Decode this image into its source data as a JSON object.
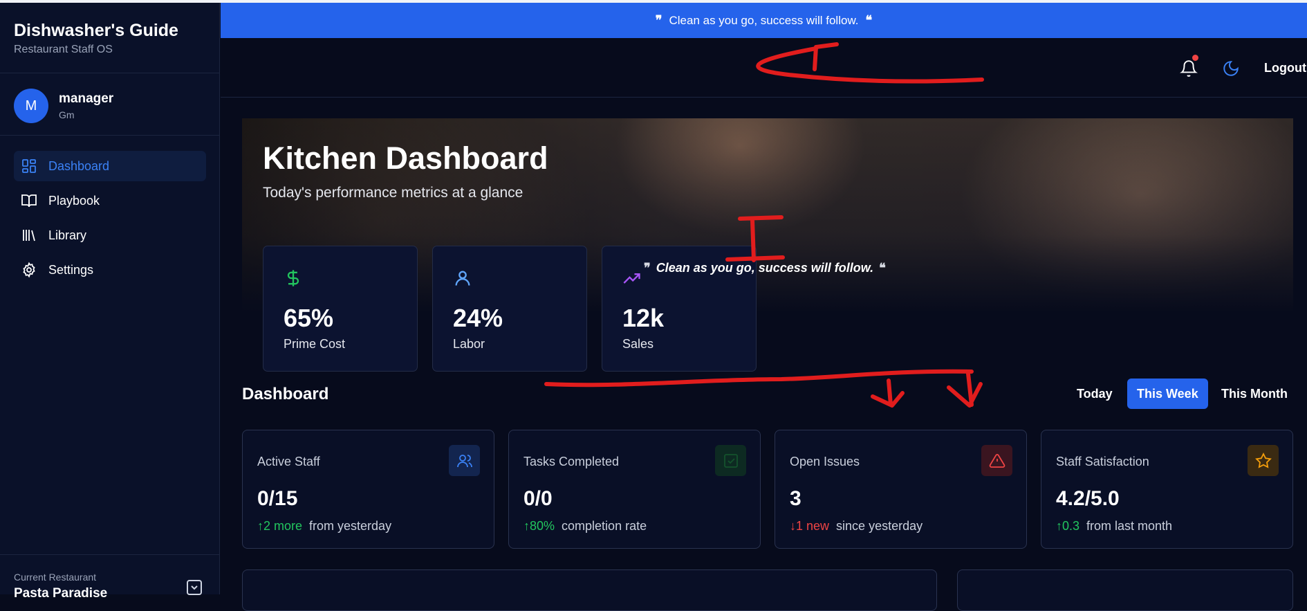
{
  "sidebar": {
    "brand_title": "Dishwasher's Guide",
    "brand_subtitle": "Restaurant Staff OS",
    "user": {
      "initial": "M",
      "name": "manager",
      "role": "Gm"
    },
    "nav": [
      {
        "label": "Dashboard",
        "icon": "dashboard-grid-icon",
        "active": true
      },
      {
        "label": "Playbook",
        "icon": "book-open-icon",
        "active": false
      },
      {
        "label": "Library",
        "icon": "library-icon",
        "active": false
      },
      {
        "label": "Settings",
        "icon": "gear-icon",
        "active": false
      }
    ],
    "current_restaurant_label": "Current Restaurant",
    "current_restaurant_name": "Pasta Paradise"
  },
  "banner": {
    "text": "Clean as you go, success will follow."
  },
  "header": {
    "notification_icon": "bell-icon",
    "theme_icon": "moon-icon",
    "logout_label": "Logout"
  },
  "hero": {
    "title": "Kitchen Dashboard",
    "subtitle": "Today's performance metrics at a glance",
    "quote": "Clean as you go, success will follow.",
    "metrics": [
      {
        "value": "65%",
        "label": "Prime Cost",
        "icon": "dollar-icon",
        "color": "#22c55e"
      },
      {
        "value": "24%",
        "label": "Labor",
        "icon": "user-icon",
        "color": "#60a5fa"
      },
      {
        "value": "12k",
        "label": "Sales",
        "icon": "trending-up-icon",
        "color": "#a855f7"
      }
    ]
  },
  "dashboard": {
    "title": "Dashboard",
    "periods": [
      "Today",
      "This Week",
      "This Month"
    ],
    "selected_period": "This Week",
    "stats": [
      {
        "title": "Active Staff",
        "value": "0/15",
        "delta": "2 more",
        "delta_dir": "up",
        "caption": "from yesterday",
        "icon": "users-icon",
        "accent": "#3b82f6"
      },
      {
        "title": "Tasks Completed",
        "value": "0/0",
        "delta": "80%",
        "delta_dir": "up",
        "caption": "completion rate",
        "icon": "check-square-icon",
        "accent": "#16a34a"
      },
      {
        "title": "Open Issues",
        "value": "3",
        "delta": "1 new",
        "delta_dir": "down",
        "caption": "since yesterday",
        "icon": "alert-triangle-icon",
        "accent": "#ef4444"
      },
      {
        "title": "Staff Satisfaction",
        "value": "4.2/5.0",
        "delta": "0.3",
        "delta_dir": "up",
        "caption": "from last month",
        "icon": "star-icon",
        "accent": "#f59e0b"
      }
    ]
  },
  "colors": {
    "accent": "#2563eb",
    "background": "#070b1c",
    "sidebar": "#0a1129",
    "annotation": "#e11d1d"
  }
}
